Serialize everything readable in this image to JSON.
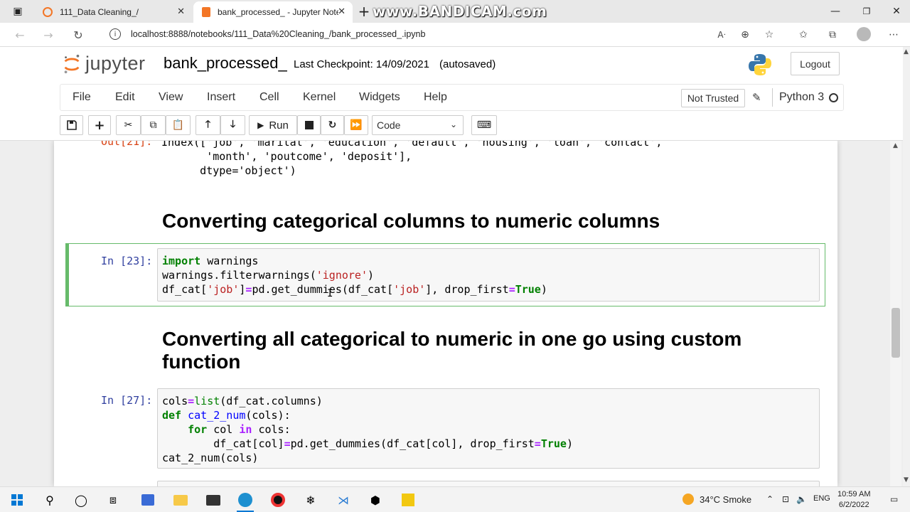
{
  "browser": {
    "tabs": [
      {
        "title": "111_Data Cleaning_/",
        "active": false
      },
      {
        "title": "bank_processed_ - Jupyter Notel",
        "active": true
      }
    ],
    "new_tab_glyph": "+",
    "url": "localhost:8888/notebooks/111_Data%20Cleaning_/bank_processed_.ipynb",
    "watermark": "www.BANDICAM.com"
  },
  "jupyter": {
    "logo_text": "jupyter",
    "notebook_name": "bank_processed_",
    "checkpoint": "Last Checkpoint: 14/09/2021",
    "autosave": "(autosaved)",
    "logout_label": "Logout",
    "menu": [
      "File",
      "Edit",
      "View",
      "Insert",
      "Cell",
      "Kernel",
      "Widgets",
      "Help"
    ],
    "trust_label": "Not Trusted",
    "kernel_name": "Python 3",
    "toolbar": {
      "run_label": "Run",
      "cell_type": "Code"
    }
  },
  "cells": {
    "out21": {
      "prompt": "Out[21]:",
      "lines": [
        "Index(['job', 'marital', 'education', 'default', 'housing', 'loan', 'contact',",
        "       'month', 'poutcome', 'deposit'],",
        "      dtype='object')"
      ]
    },
    "heading1": "Converting categorical columns to numeric columns",
    "in23": {
      "prompt": "In [23]:"
    },
    "heading2": "Converting all categorical to numeric in one go using custom function",
    "in27": {
      "prompt": "In [27]:"
    }
  },
  "taskbar": {
    "weather": "34°C  Smoke",
    "language": "ENG",
    "time": "10:59 AM",
    "date": "6/2/2022"
  },
  "colors": {
    "active_cell_border": "#66bb6a",
    "prompt_in": "#303f9f",
    "prompt_out": "#d84315",
    "keyword": "#008000",
    "string": "#ba2121"
  }
}
